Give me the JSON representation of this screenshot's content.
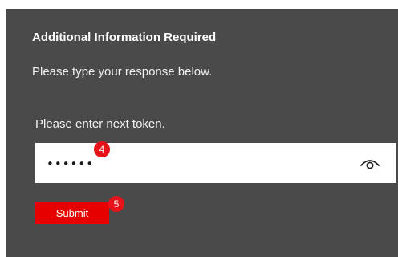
{
  "dialog": {
    "title": "Additional Information Required",
    "subtitle": "Please type your response below."
  },
  "token_field": {
    "label": "Please enter next token.",
    "value": "••••••",
    "step_badge": "4",
    "toggle_icon": "eye-icon"
  },
  "actions": {
    "submit_label": "Submit",
    "submit_step_badge": "5"
  },
  "colors": {
    "panel_background": "#4a4a4a",
    "accent_red": "#e60000",
    "badge_red": "#e8131a",
    "field_background": "#ffffff"
  }
}
